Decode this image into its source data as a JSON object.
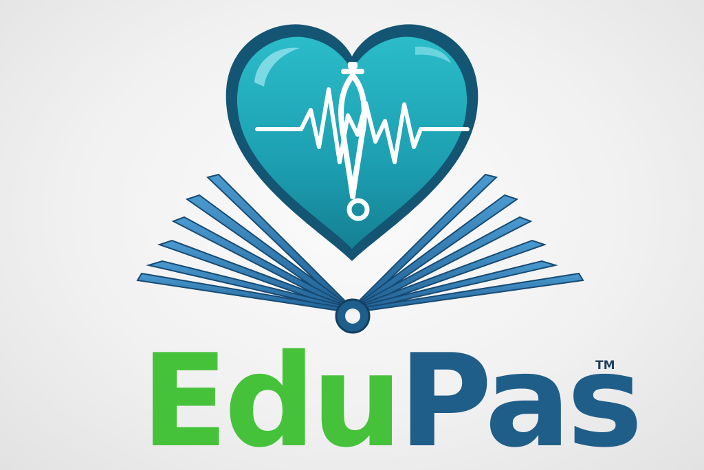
{
  "logo": {
    "emblem": "heart-with-stethoscope-pulse-over-open-book",
    "brand_part_1": "Edu",
    "brand_part_2": "Pas",
    "trademark": "TM"
  },
  "colors": {
    "heart_teal": "#1fa4b4",
    "heart_outline": "#134f6a",
    "book_blue": "#2f6fa5",
    "edu_green": "#46c23a",
    "pas_blue": "#1f5e88",
    "background": "#f1f1f1"
  }
}
